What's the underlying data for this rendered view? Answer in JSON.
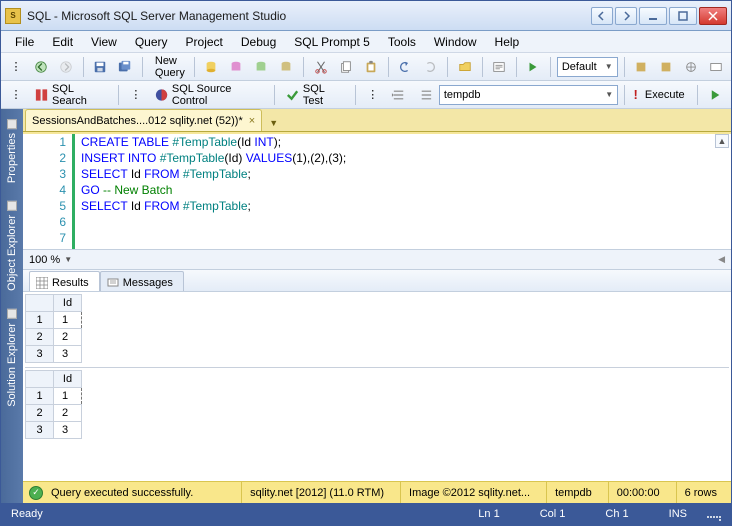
{
  "title": "SQL - Microsoft SQL Server Management Studio",
  "menu": [
    "File",
    "Edit",
    "View",
    "Query",
    "Project",
    "Debug",
    "SQL Prompt 5",
    "Tools",
    "Window",
    "Help"
  ],
  "toolbar1": {
    "newquery": "New Query",
    "config": "Default"
  },
  "toolbar2": {
    "sqlsearch": "SQL Search",
    "sqlsource": "SQL Source Control",
    "sqltest": "SQL Test",
    "db": "tempdb",
    "execute": "Execute"
  },
  "sidetabs": [
    "Properties",
    "Object Explorer",
    "Solution Explorer"
  ],
  "doctab": "SessionsAndBatches....012 sqlity.net (52))*",
  "code_lines": [
    {
      "n": "1",
      "segs": [
        {
          "c": "kw",
          "t": "CREATE TABLE "
        },
        {
          "c": "tbl",
          "t": "#TempTable"
        },
        {
          "c": "",
          "t": "("
        },
        {
          "c": "",
          "t": "Id "
        },
        {
          "c": "kw",
          "t": "INT"
        },
        {
          "c": "",
          "t": ");"
        }
      ]
    },
    {
      "n": "2",
      "segs": [
        {
          "c": "kw",
          "t": "INSERT INTO "
        },
        {
          "c": "tbl",
          "t": "#TempTable"
        },
        {
          "c": "",
          "t": "(Id) "
        },
        {
          "c": "kw",
          "t": "VALUES"
        },
        {
          "c": "",
          "t": "(1),(2),(3);"
        }
      ]
    },
    {
      "n": "3",
      "segs": [
        {
          "c": "kw",
          "t": "SELECT "
        },
        {
          "c": "",
          "t": "Id "
        },
        {
          "c": "kw",
          "t": "FROM "
        },
        {
          "c": "tbl",
          "t": "#TempTable"
        },
        {
          "c": "",
          "t": ";"
        }
      ]
    },
    {
      "n": "4",
      "segs": [
        {
          "c": "",
          "t": ""
        }
      ]
    },
    {
      "n": "5",
      "segs": [
        {
          "c": "kw",
          "t": "GO "
        },
        {
          "c": "cm",
          "t": "-- New Batch"
        }
      ]
    },
    {
      "n": "6",
      "segs": [
        {
          "c": "",
          "t": ""
        }
      ]
    },
    {
      "n": "7",
      "segs": [
        {
          "c": "kw",
          "t": "SELECT "
        },
        {
          "c": "",
          "t": "Id "
        },
        {
          "c": "kw",
          "t": "FROM "
        },
        {
          "c": "tbl",
          "t": "#TempTable"
        },
        {
          "c": "",
          "t": ";"
        }
      ]
    }
  ],
  "zoom": "100 %",
  "restabs": {
    "results": "Results",
    "messages": "Messages"
  },
  "grids": [
    {
      "header": "Id",
      "rows": [
        {
          "n": "1",
          "v": "1",
          "sel": true
        },
        {
          "n": "2",
          "v": "2"
        },
        {
          "n": "3",
          "v": "3"
        }
      ]
    },
    {
      "header": "Id",
      "rows": [
        {
          "n": "1",
          "v": "1",
          "sel": true
        },
        {
          "n": "2",
          "v": "2"
        },
        {
          "n": "3",
          "v": "3"
        }
      ]
    }
  ],
  "status1": {
    "msg": "Query executed successfully.",
    "server": "sqlity.net [2012] (11.0 RTM)",
    "user": "Image ©2012 sqlity.net...",
    "db": "tempdb",
    "time": "00:00:00",
    "rows": "6 rows"
  },
  "status2": {
    "ready": "Ready",
    "ln": "Ln 1",
    "col": "Col 1",
    "ch": "Ch 1",
    "ins": "INS"
  }
}
